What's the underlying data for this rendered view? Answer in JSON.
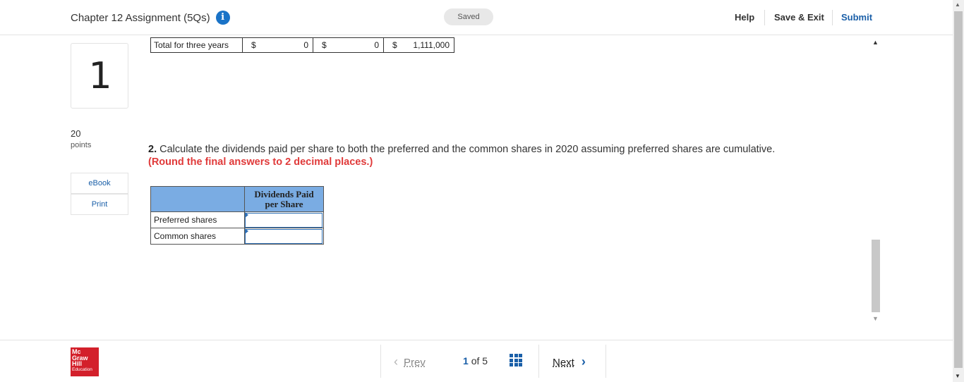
{
  "header": {
    "title": "Chapter 12 Assignment (5Qs)",
    "info_icon": "info-icon",
    "saved": "Saved",
    "help": "Help",
    "save_exit": "Save & Exit",
    "submit": "Submit"
  },
  "question_panel": {
    "number": "1",
    "points_value": "20",
    "points_label": "points",
    "ebook": "eBook",
    "print": "Print"
  },
  "total_row": {
    "label": "Total for three years",
    "cells": [
      {
        "symbol": "$",
        "value": "0"
      },
      {
        "symbol": "$",
        "value": "0"
      },
      {
        "symbol": "$",
        "value": "1,111,000"
      }
    ]
  },
  "question": {
    "number": "2.",
    "text": "Calculate the dividends paid per share to both the preferred and the common shares in 2020 assuming preferred shares are cumulative.",
    "instruction": "(Round the final answers to 2 decimal places.)"
  },
  "dividend_table": {
    "header": "Dividends Paid per Share",
    "rows": [
      {
        "label": "Preferred shares",
        "value": ""
      },
      {
        "label": "Common shares",
        "value": ""
      }
    ]
  },
  "footer": {
    "logo_lines": [
      "Mc",
      "Graw",
      "Hill",
      "Education"
    ],
    "prev": "Prev",
    "current_page": "1",
    "of": "of",
    "total_pages": "5",
    "next": "Next"
  },
  "colors": {
    "accent": "#1a5fa8",
    "highlight_red": "#e03a3a",
    "table_header": "#7aace3",
    "logo_red": "#d3202b"
  }
}
